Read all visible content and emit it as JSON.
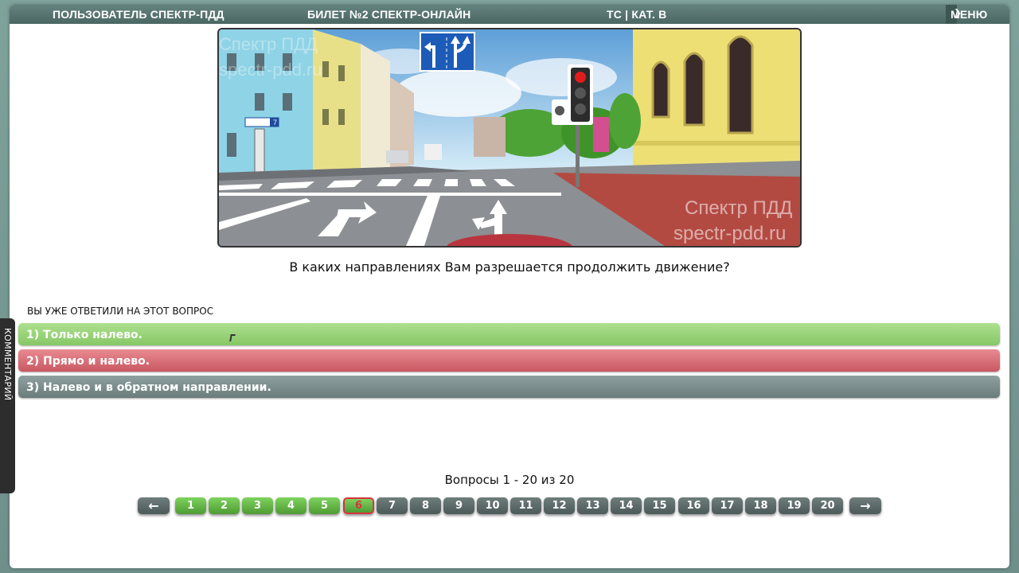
{
  "topbar": {
    "user": "ПОЛЬЗОВАТЕЛЬ СПЕКТР-ПДД",
    "ticket": "БИЛЕТ №2 СПЕКТР-ОНЛАЙН",
    "category": "ТС | КАТ. В",
    "menu_label": "МЕНЮ"
  },
  "question_image": {
    "watermark_line1": "Спектр ПДД",
    "watermark_line2": "spectr-pdd.ru",
    "street_sign": "7",
    "sign_lane_arrows": [
      "left",
      "straight-right"
    ],
    "road_arrows": [
      "right-turn",
      "left-and-u-turn"
    ],
    "traffic_light": "red"
  },
  "question": {
    "text": "В каких направлениях Вам разрешается продолжить движение?"
  },
  "answered_notice": "ВЫ УЖЕ ОТВЕТИЛИ НА ЭТОТ ВОПРОС",
  "answers": [
    {
      "label": "1) Только налево.",
      "state": "correct"
    },
    {
      "label": "2) Прямо и налево.",
      "state": "wrong"
    },
    {
      "label": "3) Налево и в обратном направлении.",
      "state": "neutral"
    }
  ],
  "side_tab": {
    "label": "КОММЕНТАРИЙ"
  },
  "pagination": {
    "summary": "Вопросы 1 - 20 из 20",
    "prev_label": "←",
    "next_label": "→",
    "pages": [
      "1",
      "2",
      "3",
      "4",
      "5",
      "6",
      "7",
      "8",
      "9",
      "10",
      "11",
      "12",
      "13",
      "14",
      "15",
      "16",
      "17",
      "18",
      "19",
      "20"
    ],
    "answered_count": 6,
    "current_page": 6
  },
  "colors": {
    "correct": "#86c765",
    "wrong": "#c85862",
    "neutral": "#6a7c7b",
    "topbar": "#4b6763",
    "page_done": "#4e9b33",
    "page_todo": "#4b5958"
  }
}
